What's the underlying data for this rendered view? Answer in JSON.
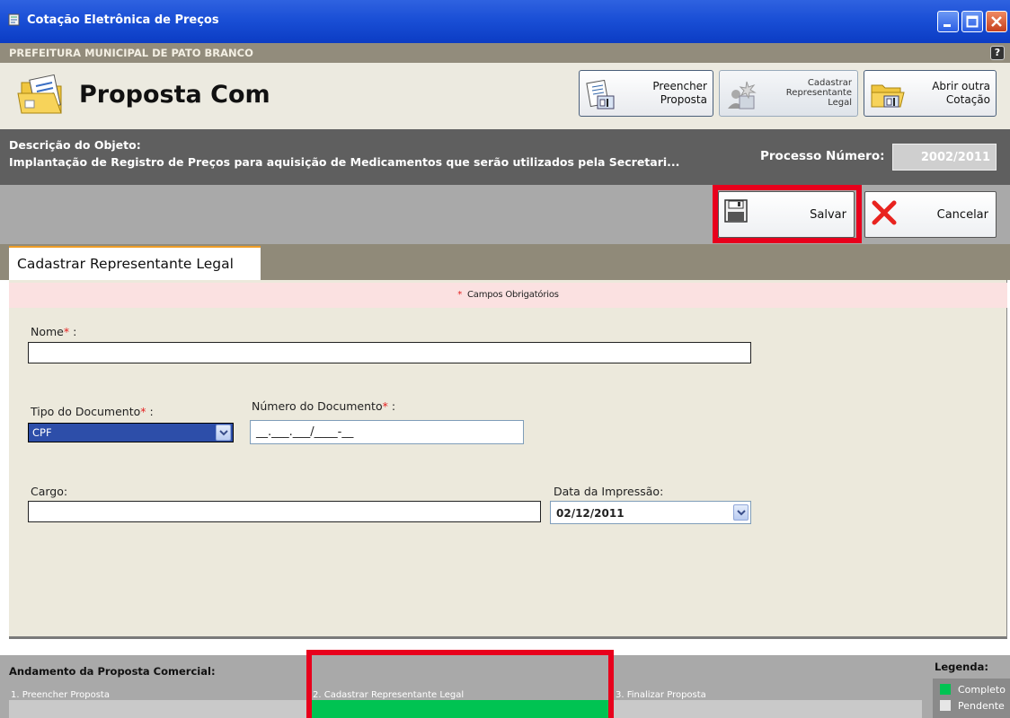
{
  "window": {
    "title": "Cotação Eletrônica de Preços",
    "municipality": "PREFEITURA MUNICIPAL DE PATO BRANCO",
    "help_label": "?"
  },
  "header": {
    "title": "Proposta Com",
    "buttons": {
      "preencher": "Preencher\nProposta",
      "cadastrar": "Cadastrar\nRepresentante\nLegal",
      "abrir": "Abrir outra\nCotação"
    }
  },
  "description": {
    "label": "Descrição do Objeto:",
    "value": "Implantação de Registro de Preços para aquisição de Medicamentos que serão utilizados pela Secretari...",
    "process_label": "Processo Número:",
    "process_value": "2002/2011"
  },
  "actions": {
    "save_label": "Salvar",
    "cancel_label": "Cancelar"
  },
  "tab": {
    "label": "Cadastrar Representante Legal"
  },
  "form": {
    "required_star": "*",
    "required_note": "Campos Obrigatórios",
    "nome_label": "Nome",
    "nome_value": "",
    "tipo_doc_label": "Tipo do Documento",
    "tipo_doc_value": "CPF",
    "numero_doc_label": "Número do Documento",
    "numero_doc_value": "__.___.___/____-__",
    "cargo_label": "Cargo:",
    "cargo_value": "",
    "data_label": "Data da Impressão:",
    "data_value": "02/12/2011",
    "colon": " :"
  },
  "progress": {
    "title": "Andamento da Proposta Comercial:",
    "steps": [
      {
        "label": "1. Preencher Proposta",
        "status": "pendente"
      },
      {
        "label": "2. Cadastrar Representante Legal",
        "status": "completo"
      },
      {
        "label": "3. Finalizar Proposta",
        "status": "pendente"
      }
    ]
  },
  "legend": {
    "title": "Legenda:",
    "completo": "Completo",
    "pendente": "Pendente",
    "completo_color": "#00c352",
    "pendente_color": "#e6e6e6"
  },
  "colors": {
    "title_bar": "#1a4fd6",
    "highlight": "#e8001c",
    "required": "#e42121"
  }
}
